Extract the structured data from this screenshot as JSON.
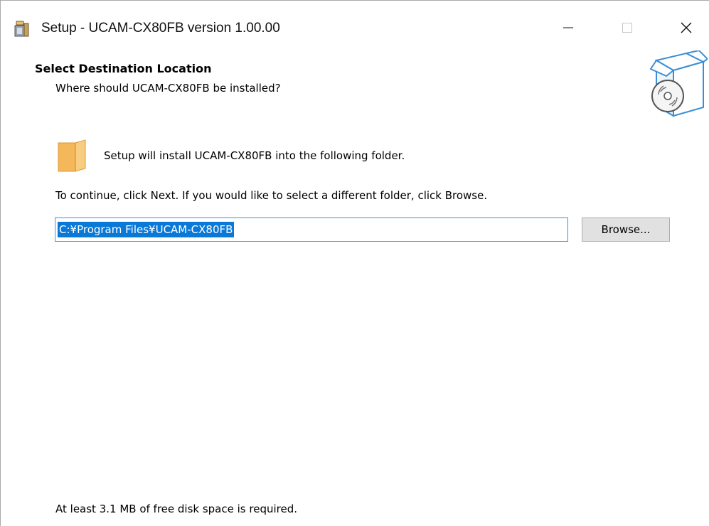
{
  "window": {
    "title": "Setup - UCAM-CX80FB version 1.00.00",
    "icons": {
      "app": "setup-app-icon",
      "minimize": "minimize-icon",
      "maximize": "maximize-icon",
      "close": "close-icon"
    }
  },
  "header": {
    "title": "Select Destination Location",
    "subtitle": "Where should UCAM-CX80FB be installed?",
    "image_icon": "box-with-disc-icon"
  },
  "body": {
    "folder_icon": "folder-icon",
    "install_text": "Setup will install UCAM-CX80FB into the following folder.",
    "continue_text": "To continue, click Next. If you would like to select a different folder, click Browse.",
    "path_value": "C:¥Program Files¥UCAM-CX80FB",
    "browse_label": "Browse...",
    "disk_space_text": "At least 3.1 MB of free disk space is required."
  },
  "colors": {
    "selection": "#0a78d7",
    "input_border": "#3c8fdc",
    "button_face": "#e1e1e1",
    "folder": "#f4b85a",
    "wizard_image_stroke": "#3b8fd6"
  }
}
